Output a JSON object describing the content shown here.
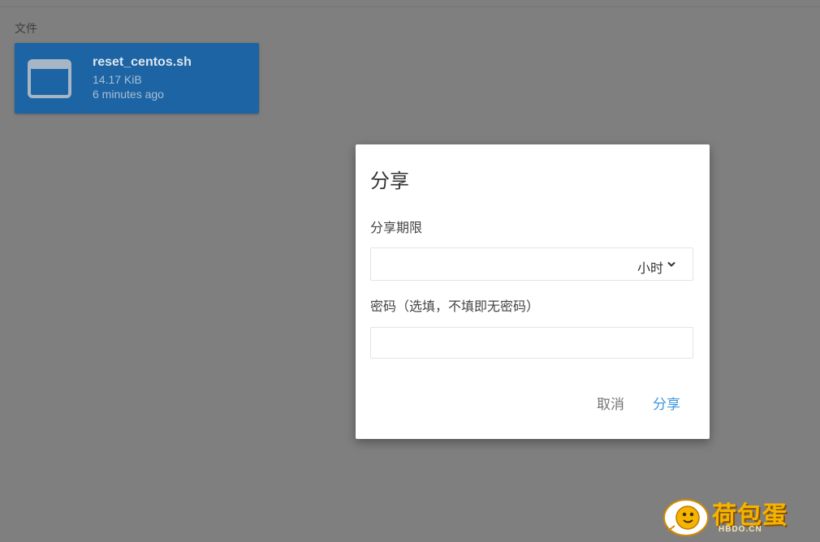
{
  "browser": {
    "section_label": "文件",
    "files": [
      {
        "name": "reset_centos.sh",
        "size": "14.17 KiB",
        "modified": "6 minutes ago",
        "icon": "file-window-icon"
      }
    ]
  },
  "dialog": {
    "title": "分享",
    "expire_label": "分享期限",
    "expire_unit": "小时",
    "password_label": "密码（选填，不填即无密码）",
    "password_value": "",
    "cancel_label": "取消",
    "share_label": "分享"
  },
  "watermark": {
    "text": "荷包蛋",
    "subtext": "HBDO.CN"
  },
  "colors": {
    "overlay": "#7f7f7f",
    "file_card": "#1c64a3",
    "accent": "#3d97e0",
    "watermark": "#f5b400"
  }
}
